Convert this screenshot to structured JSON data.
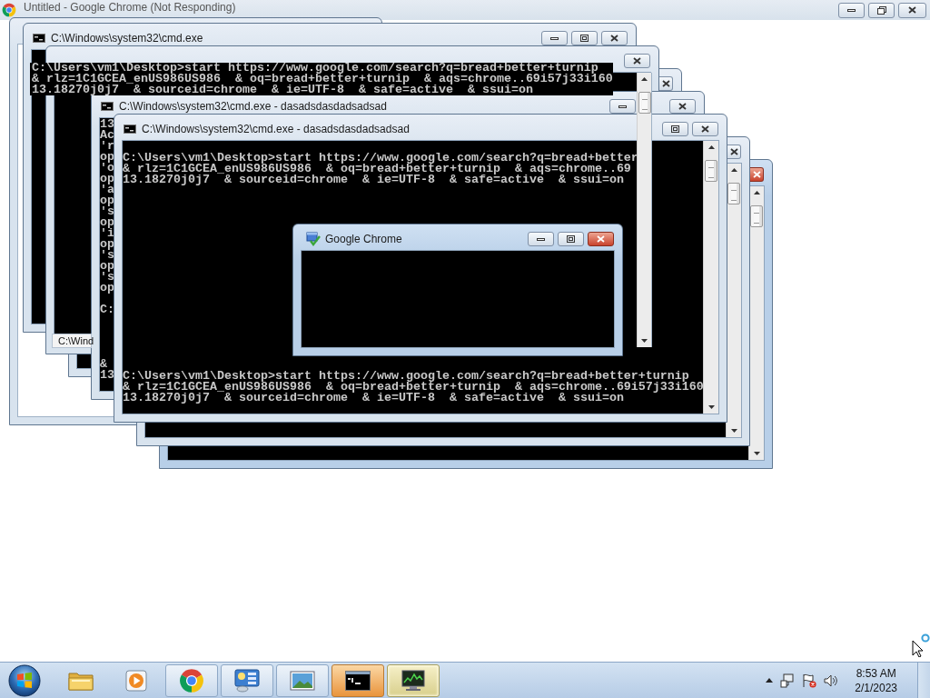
{
  "browser_window": {
    "title": "Untitled - Google Chrome (Not Responding)"
  },
  "windows": [
    {
      "kind": "frame"
    },
    {
      "kind": "console",
      "title": "C:\\Windows\\system32\\cmd.exe",
      "active": false,
      "blocks": [
        [
          "C:\\Users\\vm1\\Desktop>start https://www.google.com/search?q=bread+better+turnip",
          "& rlz=1C1GCEA_enUS986US986  & oq=bread+better+turnip  & aqs=chrome..69i57j33i160",
          "13.18270j0j7  & sourceid=chrome  & ie=UTF-8  & safe=active  & ssui=on"
        ]
      ]
    },
    {
      "kind": "console",
      "active": false
    },
    {
      "kind": "console",
      "active": false
    },
    {
      "kind": "console",
      "title": "C:\\Windows\\system32\\cmd.exe - dasadsdasdadsadsad",
      "active": false,
      "blocks": [
        [
          "13",
          "Ac",
          "'r",
          "op",
          "'o",
          "op",
          "'a",
          "op",
          "'s",
          "op",
          "'i",
          "op",
          "'s",
          "op",
          "'s",
          "op"
        ],
        [
          "C:"
        ],
        [
          "&",
          "13"
        ]
      ]
    },
    {
      "kind": "console",
      "title": "C:\\Windows\\system32\\cmd.exe - dasadsdasdadsadsad",
      "active": false,
      "blocks": [
        [
          "C:\\Users\\vm1\\Desktop>start https://www.google.com/search?q=bread+better",
          "& rlz=1C1GCEA_enUS986US986  & oq=bread+better+turnip  & aqs=chrome..69",
          "13.18270j0j7  & sourceid=chrome  & ie=UTF-8  & safe=active  & ssui=on"
        ],
        [
          "C:\\Users\\vm1\\Desktop>start https://www.google.com/search?q=bread+better+turnip",
          "& rlz=1C1GCEA_enUS986US986  & oq=bread+better+turnip  & aqs=chrome..69i57j33i160",
          "13.18270j0j7  & sourceid=chrome  & ie=UTF-8  & safe=active  & ssui=on"
        ]
      ]
    },
    {
      "kind": "console",
      "active": false
    },
    {
      "kind": "console",
      "active": true
    }
  ],
  "stray_label": {
    "text": "C:\\Wind"
  },
  "dialog": {
    "title": "Google Chrome",
    "active": true
  },
  "taskbar": {
    "items": [
      {
        "kind": "explorer",
        "running": false,
        "flashing": false,
        "selected": false
      },
      {
        "kind": "media",
        "running": false,
        "flashing": false,
        "selected": false
      },
      {
        "kind": "chrome",
        "running": true,
        "flashing": false,
        "selected": false
      },
      {
        "kind": "panel",
        "running": true,
        "flashing": false,
        "selected": false
      },
      {
        "kind": "photos",
        "running": true,
        "flashing": false,
        "selected": false
      },
      {
        "kind": "console",
        "running": true,
        "flashing": true,
        "selected": false
      },
      {
        "kind": "monitor",
        "running": true,
        "flashing": false,
        "selected": true
      }
    ],
    "clock": {
      "time": "8:53 AM",
      "date": "2/1/2023"
    }
  }
}
